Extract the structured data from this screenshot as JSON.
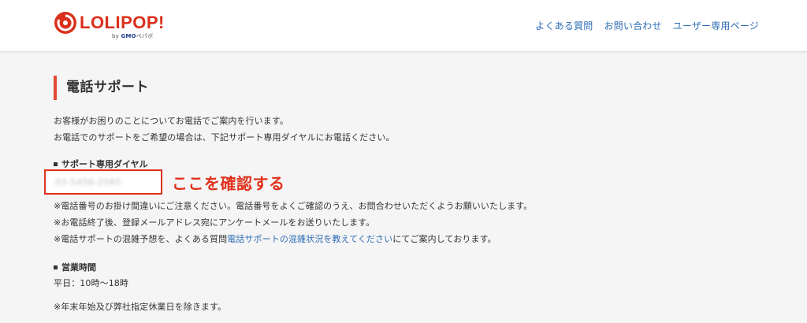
{
  "header": {
    "logo_text": "LOLIPOP!",
    "logo_sub_by": "by",
    "logo_sub_brand": "GMO",
    "logo_sub_company": "ペパボ",
    "nav": [
      "よくある質問",
      "お問い合わせ",
      "ユーザー専用ページ"
    ]
  },
  "main": {
    "title": "電話サポート",
    "intro_1": "お客様がお困りのことについてお電話でご案内を行います。",
    "intro_2": "お電話でのサポートをご希望の場合は、下記サポート専用ダイヤルにお電話ください。",
    "support_dial_heading": "サポート専用ダイヤル",
    "phone_number": "03-5456-2585",
    "callout": "ここを確認する",
    "note_1": "※電話番号のお掛け間違いにご注意ください。電話番号をよくご確認のうえ、お問合わせいただくようお願いいたします。",
    "note_2": "※お電話終了後、登録メールアドレス宛にアンケートメールをお送りいたします。",
    "note_3_before": "※電話サポートの混雑予想を、よくある質問",
    "note_3_link": "電話サポートの混雑状況を教えてください",
    "note_3_after": "にてご案内しております。",
    "hours_heading": "営業時間",
    "hours_value": "平日：10時〜18時",
    "holiday_note": "※年末年始及び弊社指定休業日を除きます。"
  },
  "colors": {
    "brand_red": "#d9301c",
    "link_blue": "#2e6cb5",
    "accent_border": "#e24a34"
  }
}
